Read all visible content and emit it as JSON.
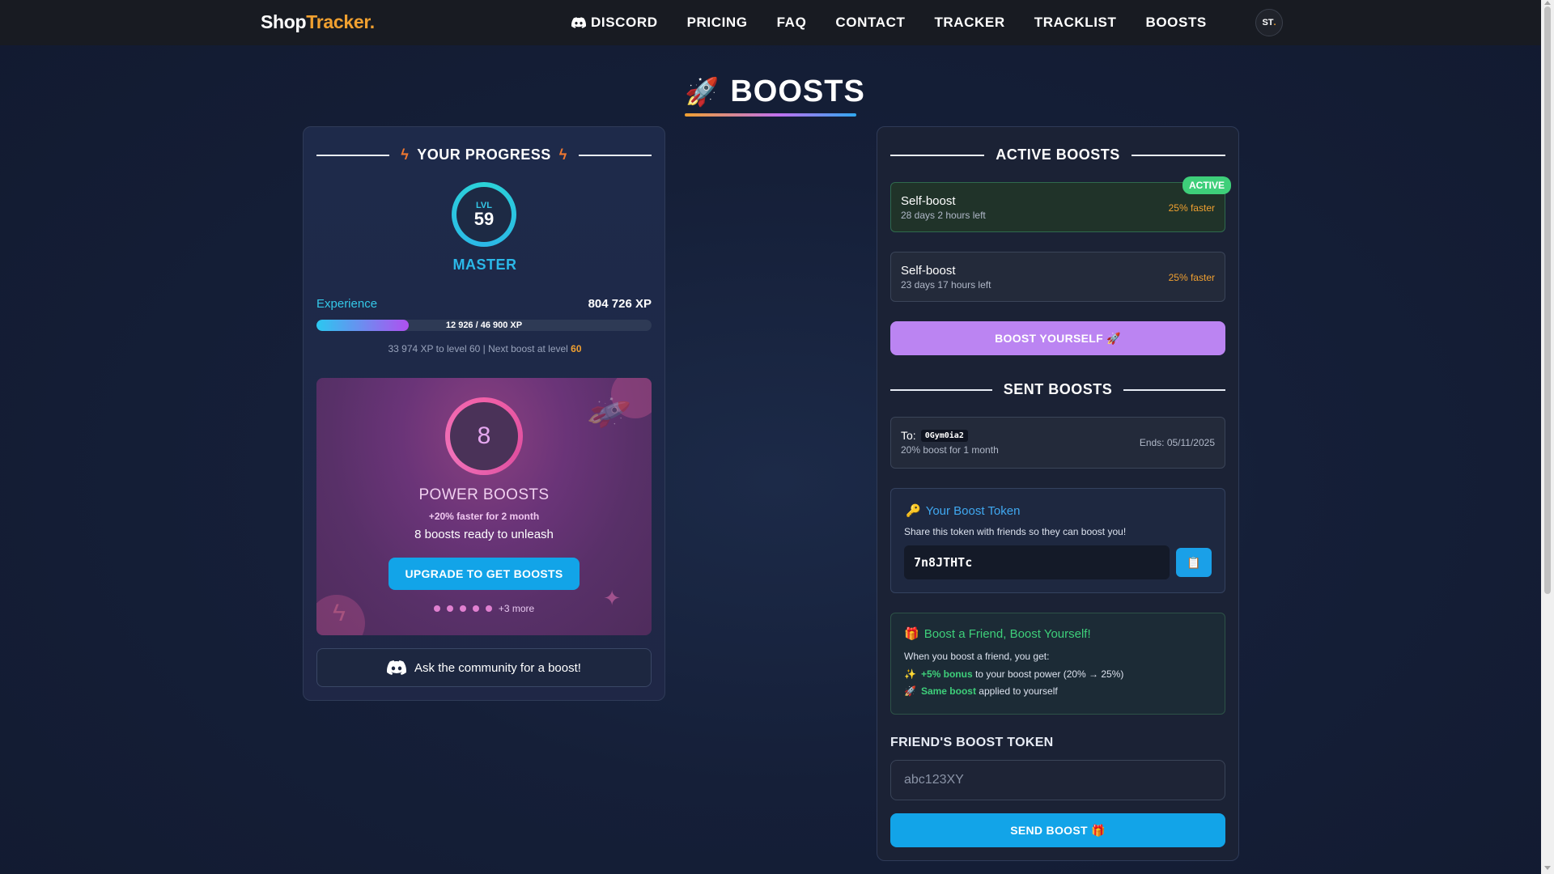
{
  "brand": {
    "part1": "Shop",
    "part2": "Tracker."
  },
  "nav": {
    "links": [
      "DISCORD",
      "PRICING",
      "FAQ",
      "CONTACT",
      "TRACKER",
      "TRACKLIST",
      "BOOSTS"
    ],
    "avatar": "ST",
    "avatar_dot": "."
  },
  "page": {
    "title": "BOOSTS",
    "title_icon": "rocket-icon"
  },
  "progress": {
    "heading": "YOUR PROGRESS",
    "level_label": "LVL",
    "level": "59",
    "rank": "MASTER",
    "experience_label": "Experience",
    "total_xp": "804 726 XP",
    "bar_text": "12 926 / 46 900 XP",
    "bar_fraction": 0.2756,
    "sub_text": "33 974 XP to level 60 | Next boost at level ",
    "next_boost_level": "60"
  },
  "power": {
    "count": "8",
    "title": "POWER BOOSTS",
    "sub1": "+20% faster for 2 month",
    "sub2": "8 boosts ready to unleash",
    "button": "UPGRADE TO GET BOOSTS",
    "more": "+3 more"
  },
  "community": {
    "label": "Ask the community for a boost!"
  },
  "active": {
    "heading": "ACTIVE BOOSTS",
    "badge": "ACTIVE",
    "items": [
      {
        "name": "Self-boost",
        "time": "28 days 2 hours left",
        "rate": "25% faster"
      },
      {
        "name": "Self-boost",
        "time": "23 days 17 hours left",
        "rate": "25% faster"
      }
    ],
    "boost_button": "BOOST YOURSELF 🚀"
  },
  "sent": {
    "heading": "SENT BOOSTS",
    "to_label": "To:",
    "to_code": "0Gym0ia2",
    "desc": "20% boost for 1 month",
    "ends": "Ends: 05/11/2025"
  },
  "token": {
    "title": "Your Boost Token",
    "desc": "Share this token with friends so they can boost you!",
    "value": "7n8JTHTc",
    "copy_icon": "clipboard-icon"
  },
  "friend": {
    "title": "Boost a Friend, Boost Yourself!",
    "desc": "When you boost a friend, you get:",
    "line1_bold": "+5% bonus",
    "line1_rest": " to your boost power (20% → 25%)",
    "line2_bold": "Same boost",
    "line2_rest": " applied to yourself",
    "input_label": "FRIEND'S BOOST TOKEN",
    "input_placeholder": "abc123XY",
    "send_button": "SEND BOOST 🎁"
  },
  "colors": {
    "accent": "#12a4e8",
    "orange": "#f0a030",
    "purple": "#bb84f2",
    "green": "#3ecf7a"
  }
}
